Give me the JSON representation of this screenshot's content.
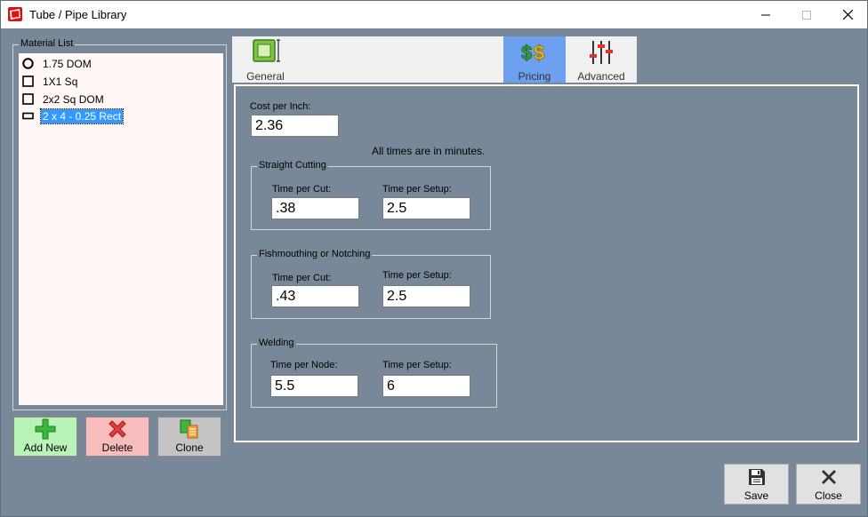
{
  "window": {
    "title": "Tube / Pipe Library"
  },
  "material_list": {
    "legend": "Material List",
    "items": [
      {
        "label": "1.75 DOM",
        "shape": "circle-icon",
        "selected": false
      },
      {
        "label": "1X1 Sq",
        "shape": "square-icon",
        "selected": false
      },
      {
        "label": "2x2 Sq DOM",
        "shape": "square-icon",
        "selected": false
      },
      {
        "label": "2 x 4 - 0.25 Rect",
        "shape": "rectangle-icon",
        "selected": true
      }
    ]
  },
  "buttons": {
    "add_new": "Add New",
    "delete": "Delete",
    "clone": "Clone",
    "save": "Save",
    "close": "Close"
  },
  "tabs": {
    "general": "General",
    "pricing": "Pricing",
    "advanced": "Advanced"
  },
  "pricing": {
    "cost_per_inch_label": "Cost per Inch:",
    "cost_per_inch": "2.36",
    "note": "All times are in minutes.",
    "straight_cutting": {
      "legend": "Straight Cutting",
      "time_per_cut_label": "Time per Cut:",
      "time_per_cut": ".38",
      "time_per_setup_label": "Time per Setup:",
      "time_per_setup": "2.5"
    },
    "fishmouthing": {
      "legend": "Fishmouthing or Notching",
      "time_per_cut_label": "Time per Cut:",
      "time_per_cut": ".43",
      "time_per_setup_label": "Time per Setup:",
      "time_per_setup": "2.5"
    },
    "welding": {
      "legend": "Welding",
      "time_per_node_label": "Time per Node:",
      "time_per_node": "5.5",
      "time_per_setup_label": "Time per Setup:",
      "time_per_setup": "6"
    }
  },
  "colors": {
    "background": "#788898",
    "selected_tab": "#6ea0f0",
    "add_button": "#b9f3b7",
    "delete_button": "#f9bcbc",
    "clone_button": "#c4c4c4",
    "selection": "#3399ff"
  }
}
